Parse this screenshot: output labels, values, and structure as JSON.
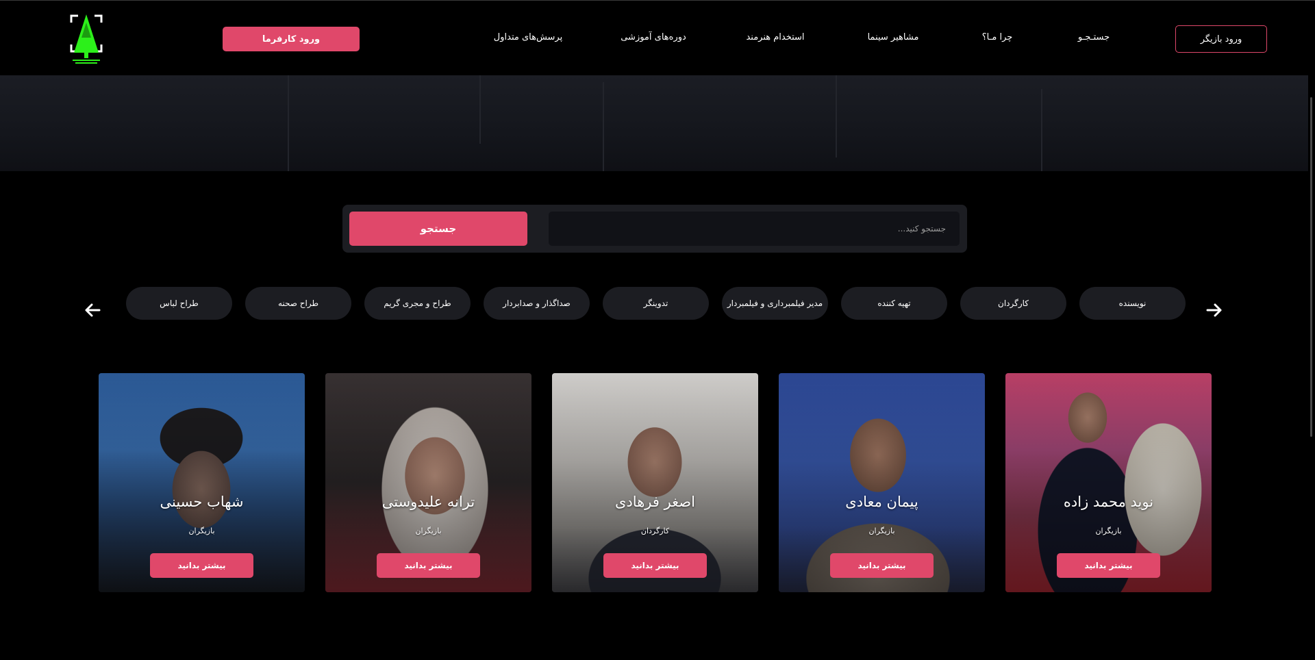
{
  "header": {
    "employer_login": "ورود کارفرما",
    "actor_login": "ورود بازیگر",
    "nav": [
      {
        "id": "faq",
        "label": "پرسش‌های متداول"
      },
      {
        "id": "courses",
        "label": "دوره‌های آموزشی"
      },
      {
        "id": "hire",
        "label": "استخدام هنرمند"
      },
      {
        "id": "celebrities",
        "label": "مشاهیر سینما"
      },
      {
        "id": "why-us",
        "label": "چرا مـا؟"
      },
      {
        "id": "search",
        "label": "جستـجـو"
      }
    ]
  },
  "search": {
    "button_label": "جستجو",
    "placeholder": "جستجو کنید..."
  },
  "categories": [
    {
      "label": "طراح لباس"
    },
    {
      "label": "طراح صحنه"
    },
    {
      "label": "طراح و مجری گریم"
    },
    {
      "label": "صداگذار و صدابردار"
    },
    {
      "label": "تدوینگر"
    },
    {
      "label": "مدیر فیلمبرداری و فیلمبردار"
    },
    {
      "label": "تهیه کننده"
    },
    {
      "label": "کارگردان"
    },
    {
      "label": "نویسنده"
    }
  ],
  "cards": [
    {
      "name": "شهاب حسینی",
      "role": "بازیگران",
      "button": "بیشتر بدانید"
    },
    {
      "name": "ترانه علیدوستی",
      "role": "بازیگران",
      "button": "بیشتر بدانید"
    },
    {
      "name": "اصغر فرهادی",
      "role": "کارگردان",
      "button": "بیشتر بدانید"
    },
    {
      "name": "پیمان معادی",
      "role": "بازیگران",
      "button": "بیشتر بدانید"
    },
    {
      "name": "نوید محمد زاده",
      "role": "بازیگران",
      "button": "بیشتر بدانید"
    }
  ],
  "colors": {
    "accent": "#e0486a",
    "background": "#000000",
    "surface": "#1c1d22",
    "logo": "#2cf01a"
  }
}
